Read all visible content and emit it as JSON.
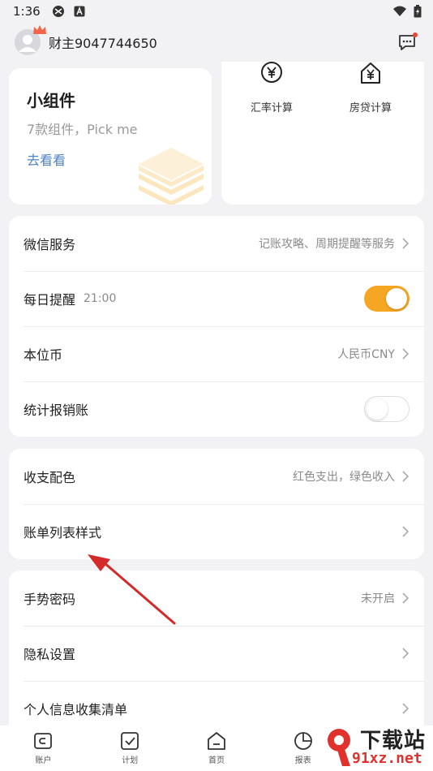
{
  "status_bar": {
    "time": "1:36",
    "icons": [
      "network-icon",
      "a-letter-icon",
      "wifi-icon",
      "battery-icon"
    ]
  },
  "header": {
    "username": "财主9047744650",
    "message_icon": "chat-bubble-icon",
    "badge_color": "#f0472a"
  },
  "widget_card": {
    "title": "小组件",
    "subtitle": "7款组件，Pick me",
    "link": "去看看"
  },
  "tools": [
    {
      "label": "汇率计算",
      "icon": "yen-circle-icon"
    },
    {
      "label": "房贷计算",
      "icon": "yen-house-icon"
    }
  ],
  "settings_group_1": {
    "wechat": {
      "label": "微信服务",
      "value": "记账攻略、周期提醒等服务"
    },
    "daily_reminder": {
      "label": "每日提醒",
      "time": "21:00",
      "enabled": true
    },
    "base_currency": {
      "label": "本位币",
      "value": "人民币CNY"
    },
    "reimburse": {
      "label": "统计报销账",
      "enabled": false
    }
  },
  "settings_group_2": {
    "color": {
      "label": "收支配色",
      "value": "红色支出，绿色收入"
    },
    "bill_style": {
      "label": "账单列表样式"
    }
  },
  "settings_group_3": {
    "gesture": {
      "label": "手势密码",
      "value": "未开启"
    },
    "privacy": {
      "label": "隐私设置"
    },
    "personal_info": {
      "label": "个人信息收集清单"
    }
  },
  "bottom_nav": [
    {
      "label": "账户",
      "icon": "account-icon"
    },
    {
      "label": "计划",
      "icon": "plan-icon"
    },
    {
      "label": "首页",
      "icon": "home-icon"
    },
    {
      "label": "报表",
      "icon": "report-icon"
    }
  ],
  "watermark": {
    "text_top": "下载站",
    "text_bottom": "91xz.net"
  },
  "colors": {
    "accent": "#f5a623",
    "link": "#4d83c4",
    "arrow": "#d42a2a"
  }
}
